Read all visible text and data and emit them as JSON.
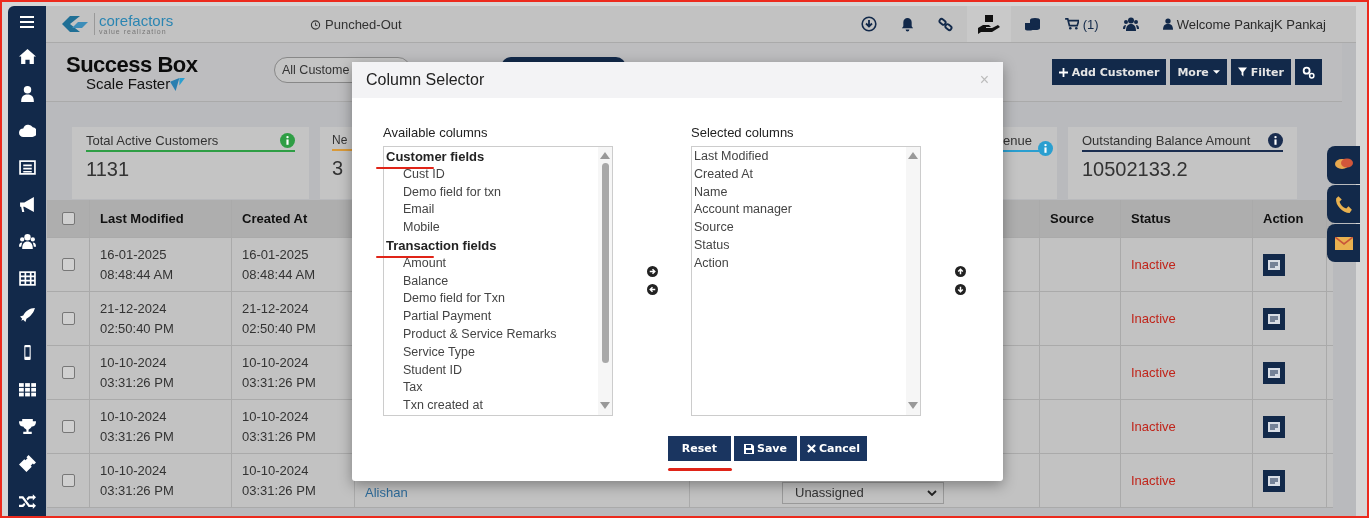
{
  "topbar": {
    "logo": "corefactors",
    "tagline": "value realization",
    "punch_status": "Punched-Out",
    "cart_count": "(1)",
    "welcome": "Welcome PankajK Pankaj"
  },
  "header": {
    "brand": "Success Box",
    "slogan": "Scale Faster",
    "view_select": "All Custome",
    "buttons": [
      {
        "kind": "add",
        "label": "Add Customer"
      },
      {
        "kind": "more",
        "label": "More"
      },
      {
        "kind": "filter",
        "label": "Filter"
      },
      {
        "kind": "settings"
      }
    ]
  },
  "stats": [
    {
      "label": "Total Active Customers",
      "value": "1131",
      "color": "#2f9e45",
      "info": true
    },
    {
      "label": "Ne",
      "value": "3",
      "color": "#d99a3a"
    },
    {
      "label": "enue",
      "color": "#2a9fd0",
      "info": true
    },
    {
      "label": "Outstanding Balance Amount",
      "value": "10502133.2",
      "color": "#1a2d4f",
      "info": true
    }
  ],
  "table": {
    "all_checked": false,
    "columns": [
      "Last Modified",
      "Created At",
      "Source",
      "Status",
      "Action"
    ],
    "rows": [
      {
        "checked": false,
        "last_date": "16-01-2025",
        "last_time": "08:48:44 AM",
        "created_date": "16-01-2025",
        "created_time": "08:48:44 AM",
        "status": "Inactive"
      },
      {
        "checked": false,
        "last_date": "21-12-2024",
        "last_time": "02:50:40 PM",
        "created_date": "21-12-2024",
        "created_time": "02:50:40 PM",
        "status": "Inactive"
      },
      {
        "checked": false,
        "last_date": "10-10-2024",
        "last_time": "03:31:26 PM",
        "created_date": "10-10-2024",
        "created_time": "03:31:26 PM",
        "status": "Inactive"
      },
      {
        "checked": false,
        "last_date": "10-10-2024",
        "last_time": "03:31:26 PM",
        "created_date": "10-10-2024",
        "created_time": "03:31:26 PM",
        "status": "Inactive"
      },
      {
        "checked": false,
        "last_date": "10-10-2024",
        "last_time": "03:31:26 PM",
        "created_date": "10-10-2024",
        "created_time": "03:31:26 PM",
        "name": "Alishan",
        "account_manager": "Unassigned",
        "status": "Inactive"
      }
    ]
  },
  "modal": {
    "title": "Column Selector",
    "close": "×",
    "available_label": "Available columns",
    "available_groups": [
      {
        "label": "Customer fields",
        "underlined": true,
        "items": [
          "Cust ID",
          "Demo field for txn",
          "Email",
          "Mobile"
        ]
      },
      {
        "label": "Transaction fields",
        "underlined": true,
        "items": [
          "Amount",
          "Balance",
          "Demo field for Txn",
          "Partial Payment",
          "Product & Service Remarks",
          "Service Type",
          "Student ID",
          "Tax",
          "Txn created at"
        ]
      }
    ],
    "selected_label": "Selected columns",
    "selected_items": [
      "Last Modified",
      "Created At",
      "Name",
      "Account manager",
      "Source",
      "Status",
      "Action"
    ],
    "buttons": [
      {
        "kind": "reset",
        "label": "Reset",
        "underlined": true
      },
      {
        "kind": "save",
        "label": "Save",
        "underlined": false
      },
      {
        "kind": "cancel",
        "label": "Cancel",
        "underlined": false
      }
    ]
  }
}
